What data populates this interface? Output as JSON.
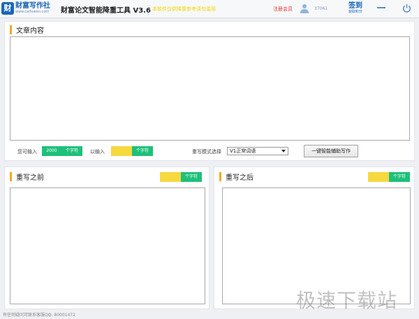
{
  "header": {
    "logo_mark": "财",
    "logo_name": "财富写作社",
    "logo_url": "www.caifuwen.com",
    "app_title": "财富论文智能降重工具 V3.6",
    "promo": "本软件仅供降重参考请勿滥用",
    "register": "注册会员",
    "user_id": "37061",
    "checkin": "签到",
    "checkin_sub": "获取积分"
  },
  "article": {
    "title": "文章内容",
    "can_input_label": "您可输入",
    "can_input_value": "2000",
    "unit": "个字符",
    "entered_label": "以输入",
    "entered_value": "",
    "mode_label": "重写模式选择",
    "mode_value": "V1正常词语",
    "submit_label": "一键智能辅助写作"
  },
  "before": {
    "title": "重写之前",
    "count_value": "",
    "unit": "个字符"
  },
  "after": {
    "title": "重写之后",
    "count_value": "",
    "unit": "个字符"
  },
  "footer": {
    "text": "有任何疑问可联系客服QQ: 80001472"
  },
  "watermark": "极速下载站",
  "colors": {
    "accent": "#f6a623",
    "green": "#1fc07a",
    "yellow": "#f6d83f",
    "brand": "#1a67b8"
  }
}
